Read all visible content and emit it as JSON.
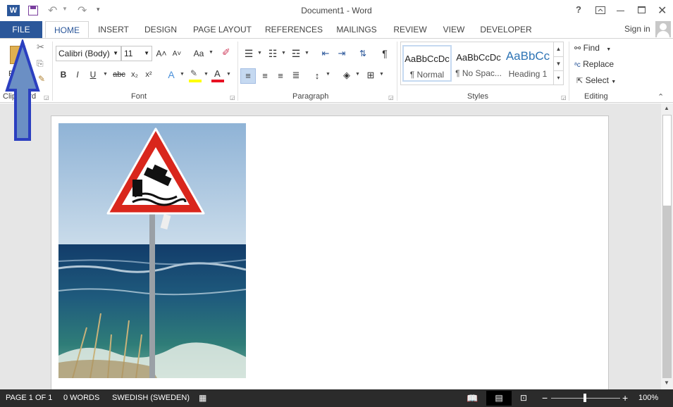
{
  "title": {
    "doc_title": "Document1 - Word",
    "help": "?",
    "undo_glyph": "↶",
    "redo_glyph": "↷"
  },
  "tabs": {
    "file": "FILE",
    "items": [
      "HOME",
      "INSERT",
      "DESIGN",
      "PAGE LAYOUT",
      "REFERENCES",
      "MAILINGS",
      "REVIEW",
      "VIEW",
      "DEVELOPER"
    ],
    "sign_in": "Sign in"
  },
  "ribbon": {
    "clipboard": {
      "label": "Clipboard",
      "paste_fragment": "P"
    },
    "font": {
      "label": "Font",
      "font_name": "Calibri (Body)",
      "font_size": "11",
      "bold": "B",
      "italic": "I",
      "underline": "U",
      "strike": "abc",
      "sub": "x₂",
      "sup": "x²",
      "grow": "A˄",
      "shrink": "A˅",
      "case": "Aa",
      "font_color": "A"
    },
    "paragraph": {
      "label": "Paragraph",
      "pilcrow": "¶"
    },
    "styles": {
      "label": "Styles",
      "tiles": [
        {
          "preview": "AaBbCcDc",
          "name": "¶ Normal"
        },
        {
          "preview": "AaBbCcDc",
          "name": "¶ No Spac..."
        },
        {
          "preview": "AaBbCc",
          "name": "Heading 1"
        }
      ]
    },
    "editing": {
      "label": "Editing",
      "find": "Find",
      "replace": "Replace",
      "select": "Select"
    }
  },
  "status": {
    "page": "PAGE 1 OF 1",
    "words": "0 WORDS",
    "language": "SWEDISH (SWEDEN)",
    "zoom": "100%"
  },
  "colors": {
    "accent": "#2b579a",
    "highlight": "#ffff00",
    "font_color": "#e81123",
    "arrow_fill": "#6b8fc4",
    "arrow_stroke": "#2b3fc0"
  }
}
